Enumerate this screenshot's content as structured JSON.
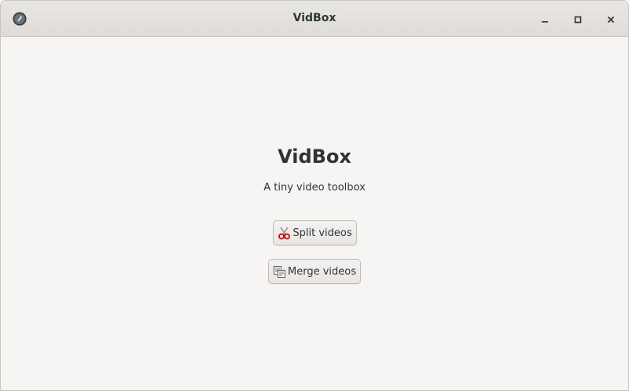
{
  "window": {
    "title": "VidBox",
    "icon": "app-logo-icon",
    "controls": {
      "minimize_icon": "minimize-icon",
      "maximize_icon": "maximize-icon",
      "close_icon": "close-icon"
    }
  },
  "main": {
    "heading": "VidBox",
    "subtitle": "A tiny video toolbox",
    "buttons": [
      {
        "label": "Split videos",
        "icon": "scissors-icon"
      },
      {
        "label": "Merge videos",
        "icon": "merge-documents-icon"
      }
    ]
  },
  "colors": {
    "background": "#f6f5f4",
    "titlebar": "#e3e1de",
    "text": "#2e3436",
    "scissors_accent": "#cc0000"
  }
}
